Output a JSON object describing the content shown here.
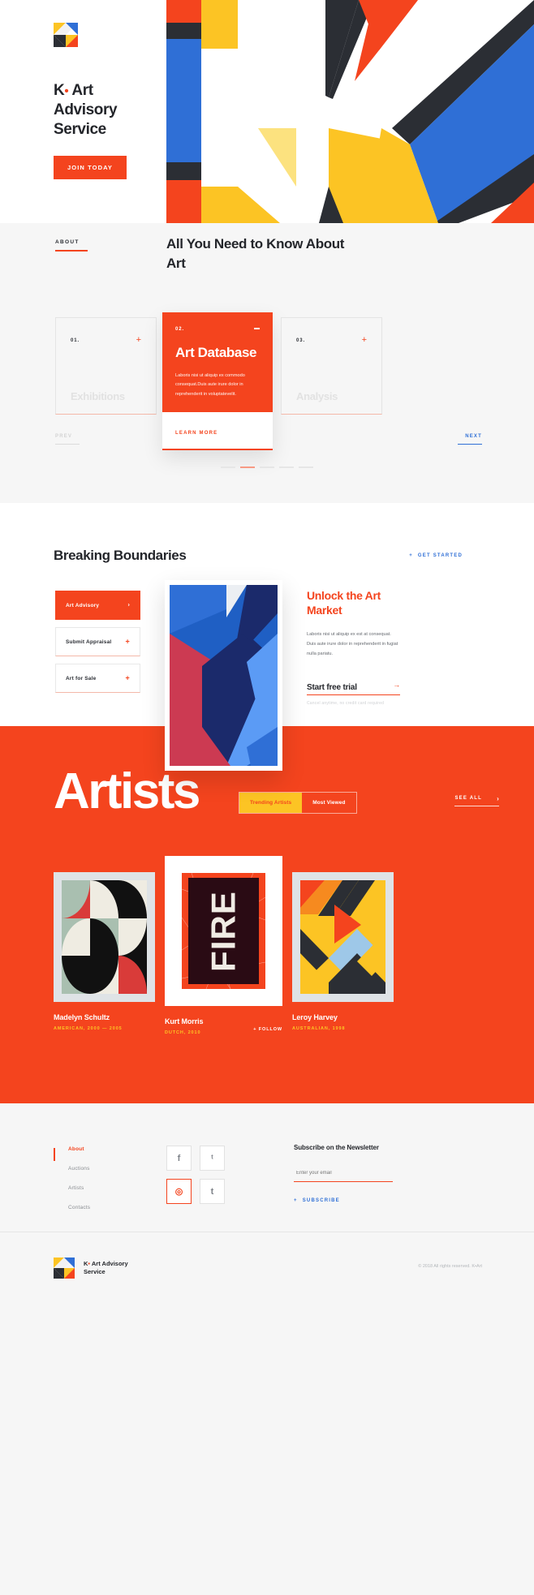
{
  "brand": {
    "name_line1": "K",
    "name_dot": "•",
    "name_line1b": "Art",
    "name_line2": "Advisory",
    "name_line3": "Service",
    "footer_name": "K• Art Advisory Service",
    "logo_icon": "k-art-logo-icon"
  },
  "hero": {
    "cta_label": "JOIN TODAY",
    "artwork_icon": "geometric-k-hero-artwork"
  },
  "about": {
    "label": "ABOUT",
    "heading": "All You Need to Know About Art",
    "prev_label": "PREV",
    "next_label": "NEXT",
    "cards": [
      {
        "num": "01.",
        "title": "Exhibitions",
        "icon": "plus-icon"
      },
      {
        "num": "02.",
        "title": "Art Database",
        "body": "Laboris nisi ut aliquip ex commodo consequat.Duis aute irure dolor in reprehenderit in voluptatevelit.",
        "link": "LEARN MORE",
        "icon": "minus-icon"
      },
      {
        "num": "03.",
        "title": "Analysis",
        "icon": "plus-icon"
      }
    ],
    "pagination": {
      "count": 5,
      "active": 2
    }
  },
  "boundaries": {
    "heading": "Breaking Boundaries",
    "cta_label": "GET STARTED",
    "cta_icon": "plus-icon",
    "accordion": [
      {
        "label": "Art Advisory",
        "icon": "chevron-right-icon",
        "active": true
      },
      {
        "label": "Submit Appraisal",
        "icon": "plus-icon",
        "active": false
      },
      {
        "label": "Art for Sale",
        "icon": "plus-icon",
        "active": false
      }
    ],
    "poster_icon": "abstract-blue-red-poster",
    "title": "Unlock the Art Market",
    "body": "Laboris nisi ut aliquip ex est at consequat. Duis aute irure dolor in reprehenderit in fugiat nulla pariatu.",
    "trial_label": "Start free trial",
    "trial_icon": "arrow-right-icon",
    "trial_note": "Cancel anytime, no credit card required"
  },
  "artists": {
    "title": "Artists",
    "toggle": {
      "active": "Trending Artists",
      "inactive": "Most Viewed"
    },
    "see_all": "SEE ALL",
    "see_all_icon": "chevron-right-icon",
    "items": [
      {
        "name": "Madelyn Schultz",
        "meta": "AMERICAN, 2000 — 2005",
        "artwork_icon": "bauhaus-circles-artwork"
      },
      {
        "name": "Kurt Morris",
        "meta": "DUTCH, 2010",
        "artwork_icon": "fire-poster-artwork",
        "follow_label": "+ FOLLOW"
      },
      {
        "name": "Leroy Harvey",
        "meta": "AUSTRALIAN, 1998",
        "artwork_icon": "yellow-chevron-artwork"
      }
    ]
  },
  "footer": {
    "nav": [
      {
        "label": "About",
        "active": true
      },
      {
        "label": "Auctions",
        "active": false
      },
      {
        "label": "Artists",
        "active": false
      },
      {
        "label": "Contacts",
        "active": false
      }
    ],
    "socials": [
      {
        "name": "facebook-icon",
        "glyph": "f",
        "highlight": false
      },
      {
        "name": "twitter-icon",
        "glyph": "ᵗ",
        "highlight": false
      },
      {
        "name": "instagram-icon",
        "glyph": "◎",
        "highlight": true
      },
      {
        "name": "tumblr-icon",
        "glyph": "t",
        "highlight": false
      }
    ],
    "newsletter": {
      "heading": "Subscribe on the Newsletter",
      "placeholder": "Enter your email",
      "submit_label": "SUBSCRIBE",
      "submit_icon": "plus-icon"
    },
    "copyright": "© 2018 All rights reserved. K•Art"
  },
  "colors": {
    "accent": "#f4441e",
    "yellow": "#fcc424",
    "blue": "#2f6fd6",
    "dark": "#2b2e34",
    "light_bg": "#f6f6f6"
  }
}
